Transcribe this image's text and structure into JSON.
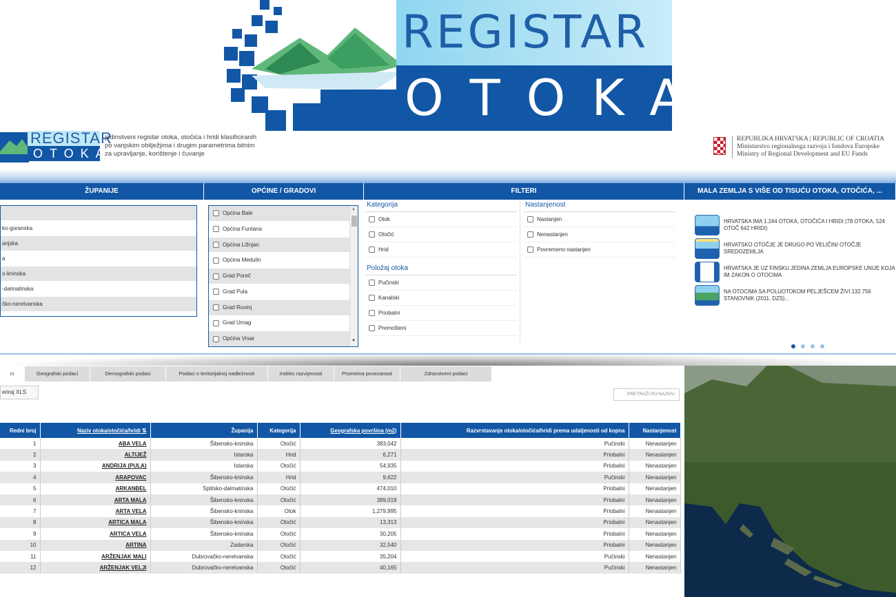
{
  "logo": {
    "big_line1": "REGISTAR",
    "big_line2": "OTOKA",
    "small_line1": "REGISTAR",
    "small_line2": "OTOKA"
  },
  "tagline": [
    "jedinstveni registar otoka, otočića i hridi klasificiranih",
    "po vanjskim obilježjima i drugim parametrima bitnim",
    "za upravljanje, korištenje i čuvanje"
  ],
  "ministry": {
    "line1": "REPUBLIKA HRVATSKA  |  REPUBLIC OF CROATIA",
    "line2": "Ministarstvo regionalnoga razvoja i fondova Europske",
    "line3": "Ministry of Regional Development and EU Funds"
  },
  "panels": {
    "zupanije": "ŽUPANIJE",
    "opcine": "OPĆINE / GRADOVI",
    "filteri": "FILTERI",
    "mala": "MALA ZEMLJA S VIŠE OD TISUĆU OTOKA, OTOČIĆA, ..."
  },
  "zupanije": [
    "",
    "ko-goranska",
    "anjska",
    "a",
    "o-kninska",
    "-dalmatinska",
    "čko-neretvanska"
  ],
  "opcine": [
    "Općina Bale",
    "Općina Funtana",
    "Općina Ližnjan",
    "Općina Medulin",
    "Grad Poreč",
    "Grad Pula",
    "Grad Rovinj",
    "Grad Umag",
    "Općina Vrsar"
  ],
  "filters": {
    "kategorija": {
      "title": "Kategorija",
      "options": [
        "Otok",
        "Otočić",
        "Hrid"
      ]
    },
    "polozaj": {
      "title": "Položaj otoka",
      "options": [
        "Pučinski",
        "Kanalski",
        "Priobalni",
        "Premošteni"
      ]
    },
    "nastanjenost": {
      "title": "Nastanjenost",
      "options": [
        "Nastanjen",
        "Nenastanjen",
        "Povremeno nastanjen"
      ]
    }
  },
  "news": [
    "HRVATSKA IMA 1.244 OTOKA, OTOČIĆA I HRIDI (78 OTOKA, 524 OTOČ 642 HRIDI)",
    "HRVATSKO OTOČJE JE DRUGO PO VELIČINI OTOČJE SREDOZEMLJA",
    "HRVATSKA JE UZ FINSKU JEDINA ZEMLJA EUROPSKE UNIJE KOJA IM ZAKON O OTOCIMA",
    "NA OTOCIMA SA POLUOTOKOM PELJEŠCEM ŽIVI 132.756 STANOVNIK (2011. DZS)..."
  ],
  "tabs": [
    "ci",
    "Geografski podaci",
    "Demografski podaci",
    "Podaci o teritorijalnoj nadležnosti",
    "Indeks razvijenosti",
    "Prometna povezanost",
    "Zdravstveni podaci"
  ],
  "buttons": {
    "xls": "eriraj XLS",
    "search": "PRETRAŽI PO NAZIVU"
  },
  "table": {
    "headers": [
      "Redni broj",
      "Naziv otoka/otočića/hridi ⇅",
      "Županija",
      "Kategorija",
      "Geografska površina (m2)",
      "Razvrstavanje otoka/otočića/hridi prema udaljenosti od kopna",
      "Nastanjenost"
    ],
    "rows": [
      [
        "1",
        "ABA VELA",
        "Šibensko-kninska",
        "Otočić",
        "383,042",
        "Pučinski",
        "Nenastanjen"
      ],
      [
        "2",
        "ALTIJEŽ",
        "Istarska",
        "Hrid",
        "6,271",
        "Priobalni",
        "Nenastanjen"
      ],
      [
        "3",
        "ANDRIJA (PULA)",
        "Istarska",
        "Otočić",
        "54,935",
        "Priobalni",
        "Nenastanjen"
      ],
      [
        "4",
        "ARAPOVAC",
        "Šibensko-kninska",
        "Hrid",
        "9,622",
        "Pučinski",
        "Nenastanjen"
      ],
      [
        "5",
        "ARKANĐEL",
        "Splitsko-dalmatinska",
        "Otočić",
        "474,010",
        "Priobalni",
        "Nenastanjen"
      ],
      [
        "6",
        "ARTA MALA",
        "Šibensko-kninska",
        "Otočić",
        "389,019",
        "Priobalni",
        "Nenastanjen"
      ],
      [
        "7",
        "ARTA VELA",
        "Šibensko-kninska",
        "Otok",
        "1,279,995",
        "Priobalni",
        "Nenastanjen"
      ],
      [
        "8",
        "ARTICA MALA",
        "Šibensko-kninska",
        "Otočić",
        "13,313",
        "Priobalni",
        "Nenastanjen"
      ],
      [
        "9",
        "ARTICA VELA",
        "Šibensko-kninska",
        "Otočić",
        "30,205",
        "Priobalni",
        "Nenastanjen"
      ],
      [
        "10",
        "ARTINA",
        "Zadarska",
        "Otočić",
        "32,540",
        "Priobalni",
        "Nenastanjen"
      ],
      [
        "11",
        "ARŽENJAK MALI",
        "Dubrovačko-neretvanska",
        "Otočić",
        "35,204",
        "Pučinski",
        "Nenastanjen"
      ],
      [
        "12",
        "ARŽENJAK VELJI",
        "Dubrovačko-neretvanska",
        "Otočić",
        "40,165",
        "Pučinski",
        "Nenastanjen"
      ]
    ]
  },
  "colors": {
    "primary": "#1257a6",
    "sky": "#bfe7f6",
    "row_alt": "#e6e6e6"
  }
}
